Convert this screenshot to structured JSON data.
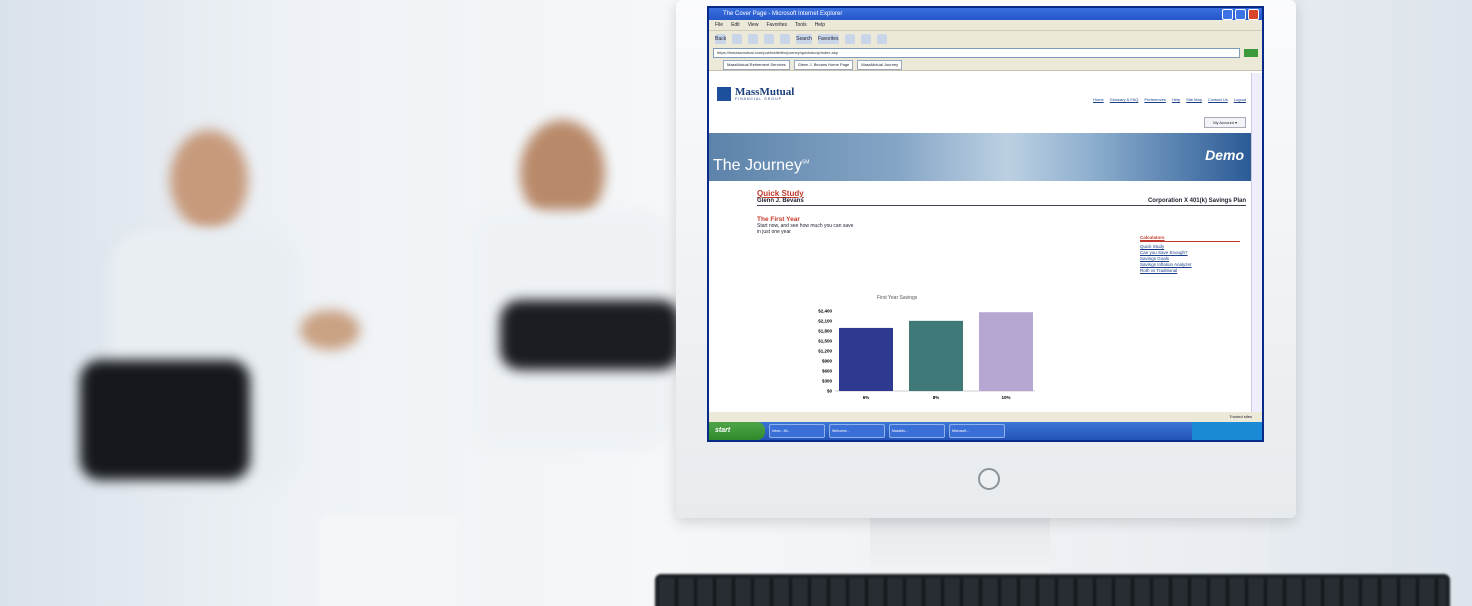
{
  "browser": {
    "title": "The Cover Page - Microsoft Internet Explorer",
    "menu": [
      "File",
      "Edit",
      "View",
      "Favorites",
      "Tools",
      "Help"
    ],
    "toolbar": [
      "Back",
      "Search",
      "Favorites"
    ],
    "address": "https://ismassmutual.com/publicsite/thejourney/quickstudy/index.asp",
    "tabs": [
      "MassMutual Retirement Services",
      "Glenn J. Bevans Home Page",
      "MassMutual Journey"
    ]
  },
  "site": {
    "logo_name": "MassMutual",
    "logo_sub": "FINANCIAL GROUP",
    "top_links": [
      "Home",
      "Glossary & FAQ",
      "Preferences",
      "Help",
      "Site Map",
      "Contact Us",
      "Logout"
    ],
    "my_account": "My Account ▾",
    "banner_title": "The Journey",
    "banner_tm": "SM",
    "demo_label": "Demo"
  },
  "content": {
    "heading": "Quick Study",
    "name": "Glenn J. Bevans",
    "plan": "Corporation X 401(k) Savings Plan",
    "section": "The First Year",
    "intro_bold": "Start now, and see how much you can save",
    "intro_rest": "in just one year",
    "calculators_title": "Calculators",
    "calculators": [
      "Quick Study",
      "Can you Save Enough?",
      "Savings Goals",
      "Savings Inflation Analyzer",
      "Roth vs Traditional"
    ]
  },
  "chart_data": {
    "type": "bar",
    "title": "First Year Savings",
    "categories": [
      "6%",
      "8%",
      "10%"
    ],
    "values": [
      2050,
      2280,
      2560
    ],
    "ylim": [
      0,
      2600
    ],
    "yticks": [
      "$2,400",
      "$2,100",
      "$1,800",
      "$1,500",
      "$1,200",
      "$900",
      "$600",
      "$300",
      "$0"
    ],
    "colors": [
      "#2d3a8f",
      "#3f7a78",
      "#b5a6d2"
    ]
  },
  "statusbar": {
    "zone": "Trusted sites"
  },
  "taskbar": {
    "start": "start",
    "tasks": [
      "Inbox - Mi...",
      "Welcome...",
      "MassMu...",
      "Microsoft..."
    ]
  }
}
